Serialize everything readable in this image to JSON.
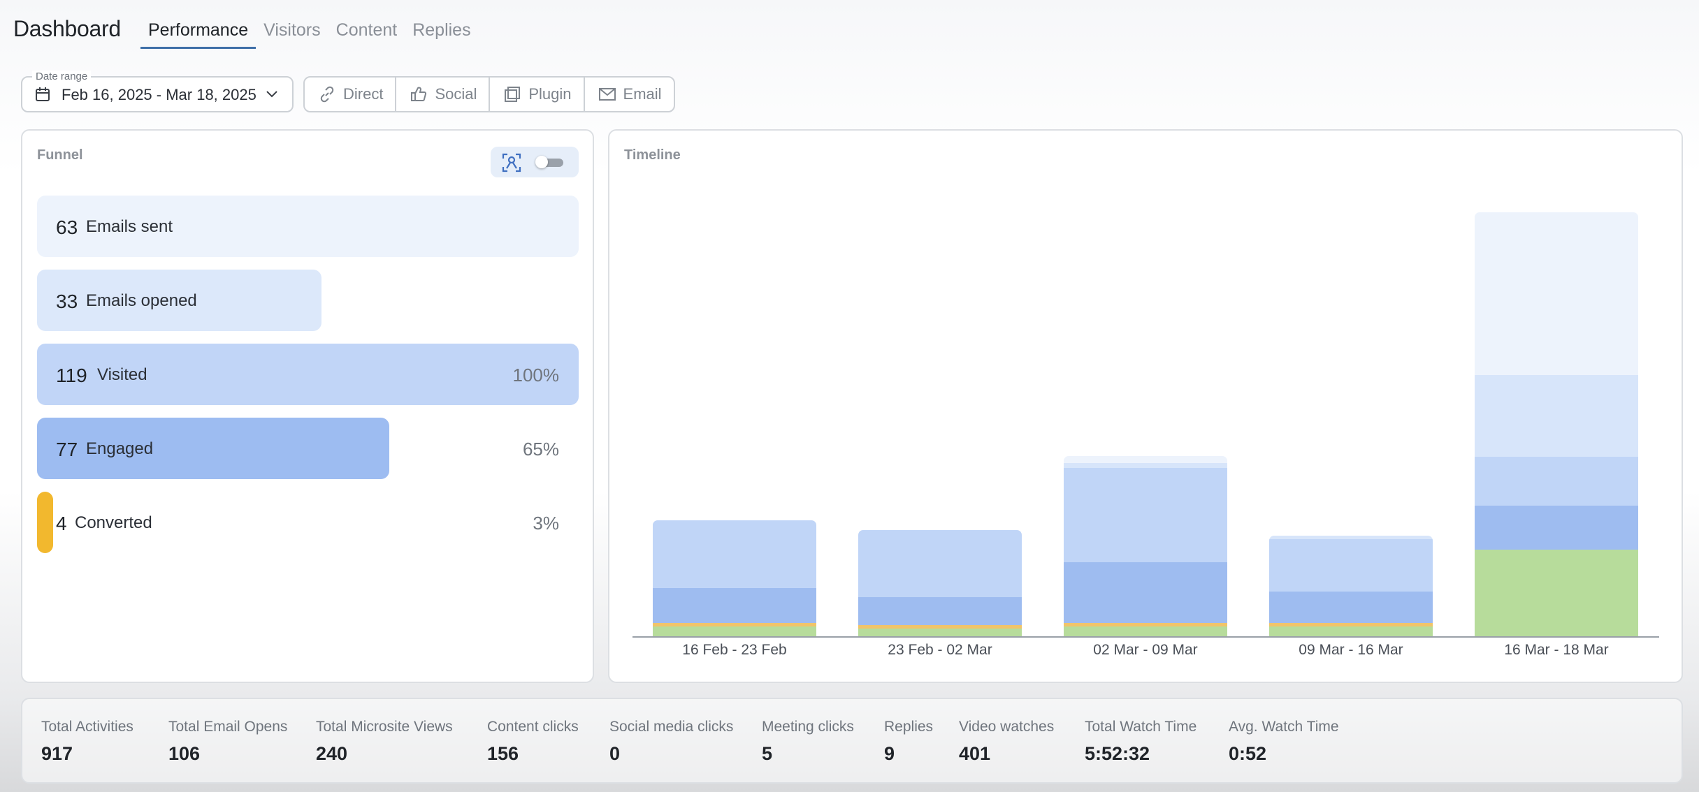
{
  "header": {
    "title": "Dashboard",
    "tabs": [
      {
        "label": "Performance",
        "active": true
      },
      {
        "label": "Visitors",
        "active": false
      },
      {
        "label": "Content",
        "active": false
      },
      {
        "label": "Replies",
        "active": false
      }
    ]
  },
  "filters": {
    "date_range_label": "Date range",
    "date_range_value": "Feb 16, 2025 - Mar 18, 2025",
    "calendar_icon": "calendar-icon",
    "chevron_icon": "chevron-down-icon",
    "sources": [
      {
        "label": "Direct",
        "icon": "link-icon"
      },
      {
        "label": "Social",
        "icon": "thumbs-up-icon"
      },
      {
        "label": "Plugin",
        "icon": "plugin-icon"
      },
      {
        "label": "Email",
        "icon": "envelope-icon"
      }
    ]
  },
  "funnel": {
    "title": "Funnel",
    "toggle_icon": "person-scan-icon",
    "toggle_on": false,
    "rows": [
      {
        "count": "63",
        "label": "Emails sent",
        "percent": "",
        "fill": 1.0,
        "color": "#edf3fc"
      },
      {
        "count": "33",
        "label": "Emails opened",
        "percent": "",
        "fill": 0.525,
        "color": "#dce8fa"
      },
      {
        "count": "119",
        "label": "Visited",
        "percent": "100%",
        "fill": 1.0,
        "color": "#c1d5f7"
      },
      {
        "count": "77",
        "label": "Engaged",
        "percent": "65%",
        "fill": 0.65,
        "color": "#9dbcf1"
      },
      {
        "count": "4",
        "label": "Converted",
        "percent": "3%",
        "fill": 0.03,
        "color": "#f2b82e"
      }
    ]
  },
  "timeline": {
    "title": "Timeline",
    "chart_data": {
      "type": "bar",
      "stacked": true,
      "categories": [
        "16 Feb - 23 Feb",
        "23 Feb - 02 Mar",
        "02 Mar - 09 Mar",
        "09 Mar - 16 Mar",
        "16 Mar - 18 Mar"
      ],
      "ylim": [
        0,
        625
      ],
      "grid": false,
      "legend": "none",
      "series": [
        {
          "color": "#b7dc9b",
          "values": [
            15,
            12,
            15,
            15,
            125
          ]
        },
        {
          "color": "#f0c46a",
          "values": [
            5,
            5,
            5,
            5,
            0
          ]
        },
        {
          "color": "#9ebcf0",
          "values": [
            50,
            40,
            87,
            45,
            63
          ]
        },
        {
          "color": "#c0d5f7",
          "values": [
            97,
            96,
            135,
            75,
            70
          ]
        },
        {
          "color": "#d7e5fa",
          "values": [
            0,
            0,
            7,
            5,
            117
          ]
        },
        {
          "color": "#edf3fc",
          "values": [
            0,
            0,
            10,
            0,
            233
          ]
        }
      ]
    }
  },
  "stats": [
    {
      "label": "Total Activities",
      "value": "917"
    },
    {
      "label": "Total Email Opens",
      "value": "106"
    },
    {
      "label": "Total Microsite Views",
      "value": "240"
    },
    {
      "label": "Content clicks",
      "value": "156"
    },
    {
      "label": "Social media clicks",
      "value": "0"
    },
    {
      "label": "Meeting clicks",
      "value": "5"
    },
    {
      "label": "Replies",
      "value": "9"
    },
    {
      "label": "Video watches",
      "value": "401"
    },
    {
      "label": "Total Watch Time",
      "value": "5:52:32"
    },
    {
      "label": "Avg. Watch Time",
      "value": "0:52"
    }
  ]
}
